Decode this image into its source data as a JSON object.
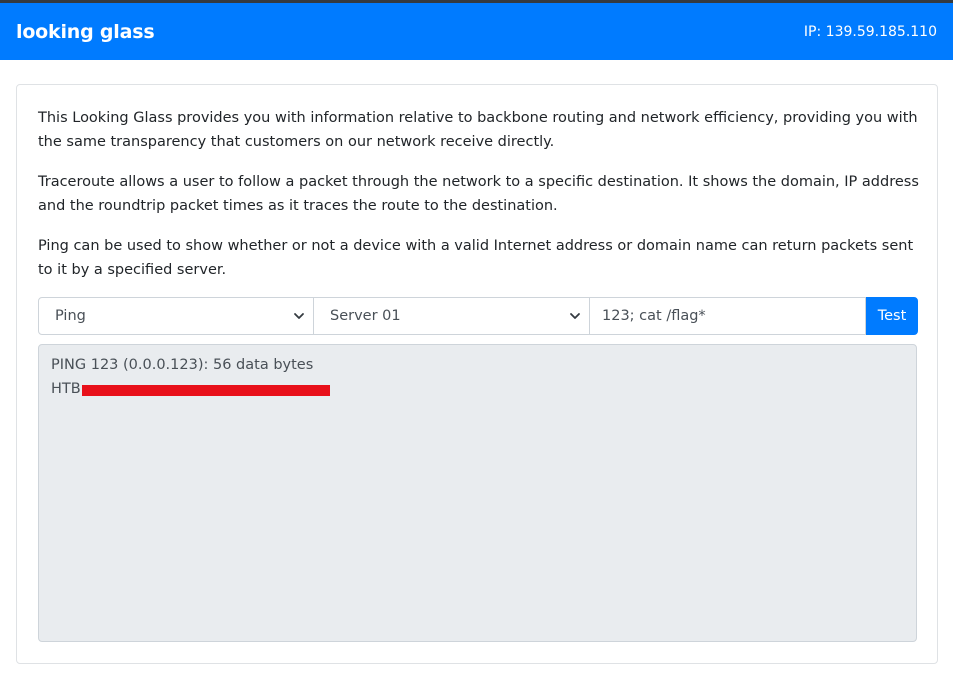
{
  "navbar": {
    "brand": "looking glass",
    "ip_text": "IP: 139.59.185.110"
  },
  "intro": {
    "paragraphs": [
      "This Looking Glass provides you with information relative to backbone routing and network efficiency, providing you with the same transparency that customers on our network receive directly.",
      "Traceroute allows a user to follow a packet through the network to a specific destination. It shows the domain, IP address and the roundtrip packet times as it traces the route to the destination.",
      "Ping can be used to show whether or not a device with a valid Internet address or domain name can return packets sent to it by a specified server."
    ]
  },
  "form": {
    "test_type": {
      "selected": "Ping",
      "icon": "chevron-down-icon"
    },
    "server": {
      "selected": "Server 01",
      "icon": "chevron-down-icon"
    },
    "command_value": "123; cat /flag*",
    "submit_label": "Test"
  },
  "output": {
    "lines": [
      "PING 123 (0.0.0.123): 56 data bytes",
      "HTB"
    ],
    "redaction_color": "#e8101a"
  },
  "colors": {
    "primary": "#007bff",
    "output_bg": "#e9ecef"
  }
}
